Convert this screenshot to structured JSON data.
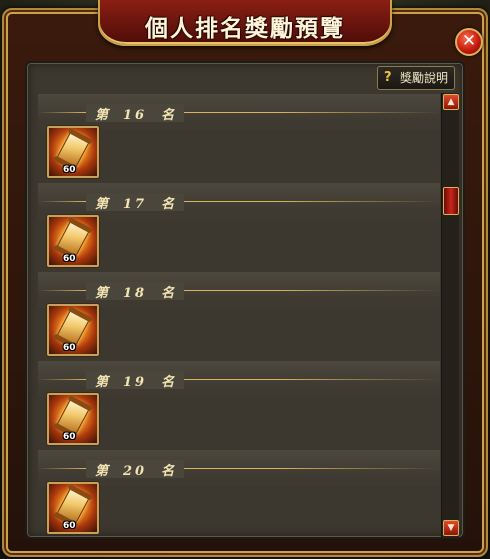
{
  "window": {
    "title": "個人排名獎勵預覽",
    "close_symbol": "✕",
    "close_icon": "close-icon"
  },
  "toolbar": {
    "explain_label": "獎勵說明",
    "explain_icon_glyph": "?"
  },
  "rank_prefix": "第",
  "rank_suffix": "名",
  "ranks": [
    {
      "rank": "16",
      "reward_icon": "scroll-icon",
      "reward_qty": "60"
    },
    {
      "rank": "17",
      "reward_icon": "scroll-icon",
      "reward_qty": "60"
    },
    {
      "rank": "18",
      "reward_icon": "scroll-icon",
      "reward_qty": "60"
    },
    {
      "rank": "19",
      "reward_icon": "scroll-icon",
      "reward_qty": "60"
    },
    {
      "rank": "20",
      "reward_icon": "scroll-icon",
      "reward_qty": "60"
    }
  ],
  "scrollbar": {
    "up_glyph": "▲",
    "down_glyph": "▼",
    "position_fraction": 0.2
  },
  "colors": {
    "title_bg": "#8a1f14",
    "gold_trim": "#c9a24a",
    "panel_bg": "#3c382f",
    "rank_text": "#f4e4b4"
  }
}
